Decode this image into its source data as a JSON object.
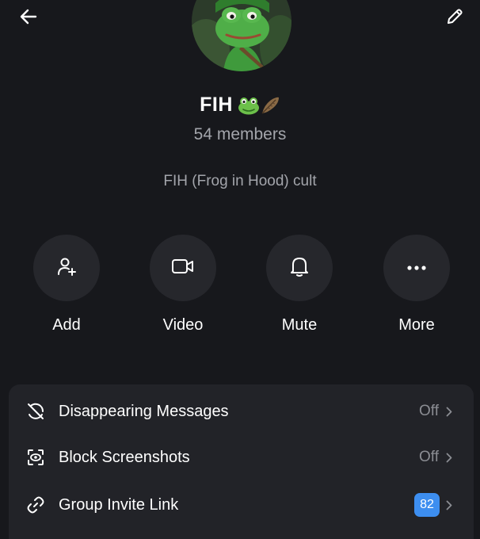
{
  "header": {
    "back_icon": "arrow-left-icon",
    "edit_icon": "pencil-icon"
  },
  "group": {
    "name": "FIH",
    "emojis": [
      "frog-face-emoji",
      "feather-emoji"
    ],
    "members": "54 members",
    "description": "FIH (Frog in Hood) cult",
    "avatar": "frog-in-hood-avatar"
  },
  "actions": [
    {
      "label": "Add",
      "icon": "add-person-icon"
    },
    {
      "label": "Video",
      "icon": "video-camera-icon"
    },
    {
      "label": "Mute",
      "icon": "bell-icon"
    },
    {
      "label": "More",
      "icon": "more-horizontal-icon"
    }
  ],
  "settings": [
    {
      "label": "Disappearing Messages",
      "value": "Off",
      "icon": "timer-off-icon"
    },
    {
      "label": "Block Screenshots",
      "value": "Off",
      "icon": "screenshot-block-icon"
    },
    {
      "label": "Group Invite Link",
      "badge": "82",
      "icon": "link-icon"
    }
  ],
  "colors": {
    "background": "#17181c",
    "card": "#222328",
    "action_circle": "#26272c",
    "muted_text": "#a3a5ab",
    "badge": "#3d8ef0",
    "frog_green": "#3f9a3c"
  }
}
